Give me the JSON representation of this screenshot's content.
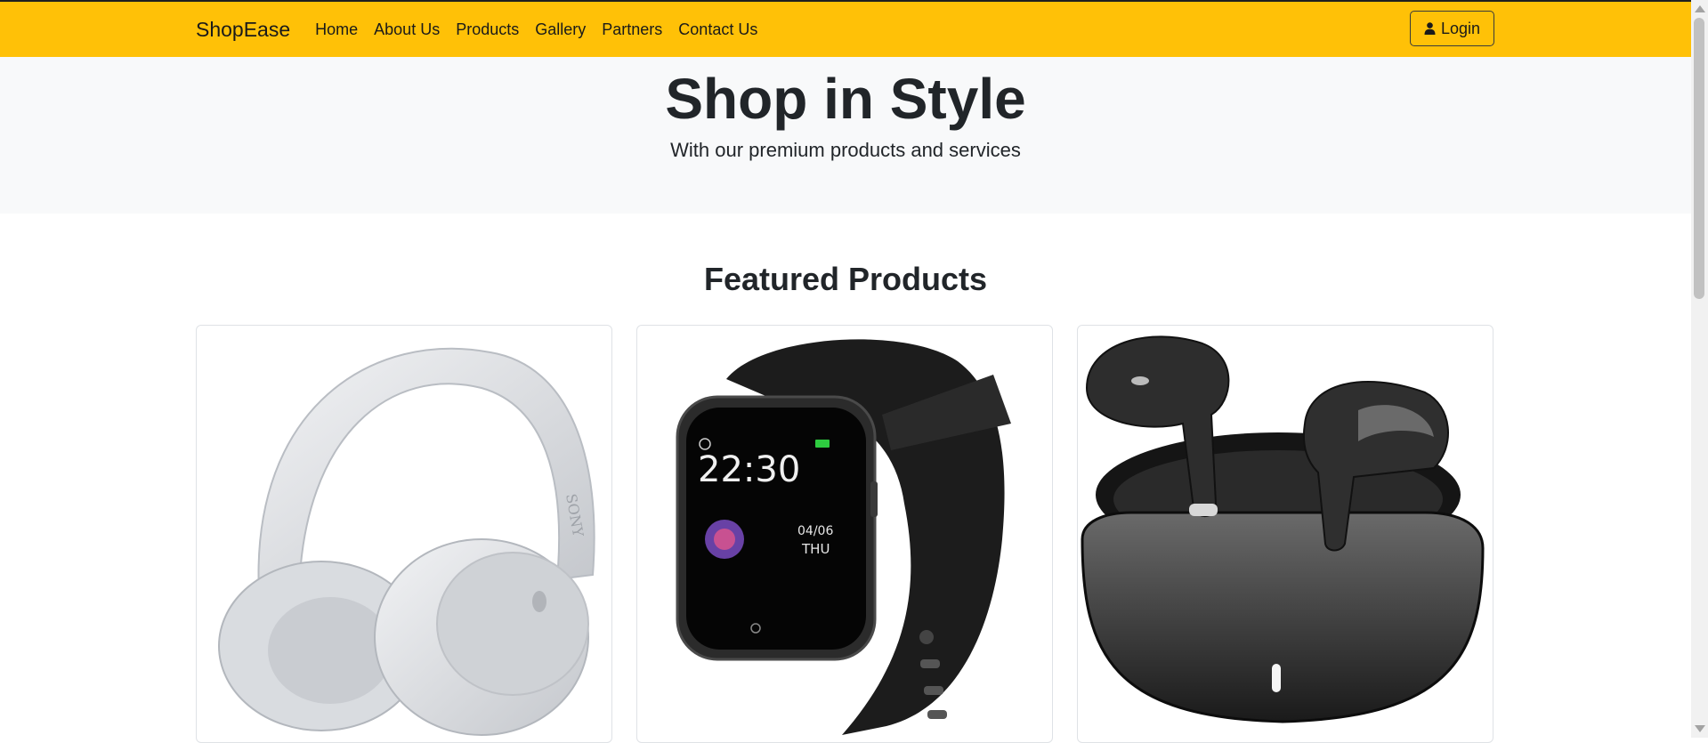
{
  "navbar": {
    "brand": "ShopEase",
    "links": [
      "Home",
      "About Us",
      "Products",
      "Gallery",
      "Partners",
      "Contact Us"
    ],
    "login_label": "Login",
    "login_icon": "user-icon",
    "background": "#ffc107"
  },
  "hero": {
    "title": "Shop in Style",
    "subtitle": "With our premium products and services",
    "background": "#f8f9fa"
  },
  "featured": {
    "title": "Featured Products",
    "products": [
      {
        "image": "white-over-ear-headphones",
        "brand_mark": "SONY"
      },
      {
        "image": "black-smartwatch",
        "time": "22:30",
        "date": "04/06",
        "day": "THU"
      },
      {
        "image": "black-wireless-earbuds-case"
      }
    ]
  }
}
